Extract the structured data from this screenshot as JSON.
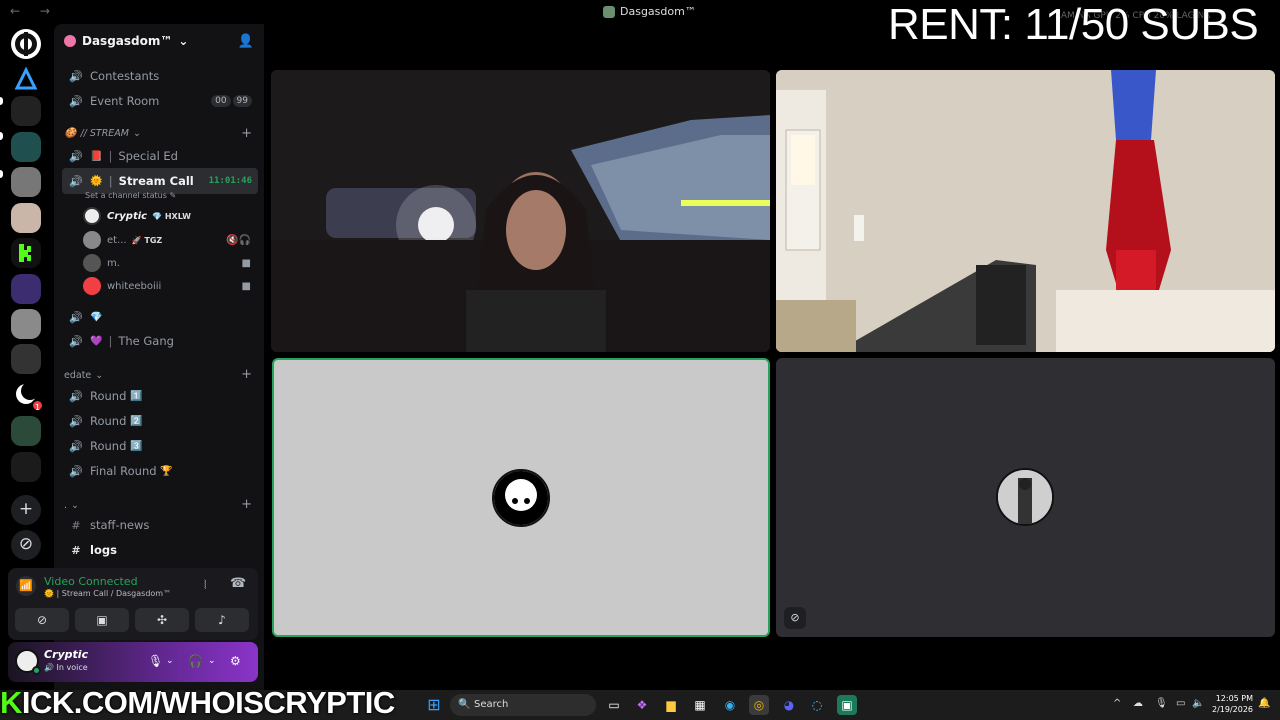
{
  "window": {
    "title": "Dasgasdom™",
    "nav_arrows": "← →"
  },
  "overlay": {
    "rent_text": "RENT: 11/50 SUBS",
    "stats_text": "RAM NA GPU 2% CPU 28% LAG NA",
    "kick_prefix": "K",
    "kick_text": "ICK.COM/WHOISCRYPTIC"
  },
  "server": {
    "name": "Dasgasdom™",
    "chevron": "⌄"
  },
  "channels_top": [
    {
      "name": "Contestants",
      "icon": "speaker"
    },
    {
      "name": "Event Room",
      "icon": "speaker",
      "count_a": "00",
      "count_b": "99"
    }
  ],
  "categories": {
    "stream": "// STREAM",
    "edate": "edate",
    "dot": "."
  },
  "stream_channels": [
    {
      "emoji": "📕",
      "name": "Special Ed"
    },
    {
      "emoji": "🌞",
      "name": "Stream Call",
      "timer": "11:01:46",
      "status": "Set a channel status ✎"
    },
    {
      "emoji": "💎",
      "name": ""
    },
    {
      "emoji": "💜",
      "name": "The Gang"
    }
  ],
  "voice_users": [
    {
      "name": "Cryptic",
      "tag": "HXLW"
    },
    {
      "name": "et...",
      "tag": "TGZ"
    },
    {
      "name": "m.",
      "tag": ""
    },
    {
      "name": "whiteeboiii",
      "tag": ""
    }
  ],
  "edate_channels": [
    {
      "name": "Round",
      "emoji": "1️⃣"
    },
    {
      "name": "Round",
      "emoji": "2️⃣"
    },
    {
      "name": "Round",
      "emoji": "3️⃣"
    },
    {
      "name": "Final Round",
      "emoji": "🏆"
    }
  ],
  "text_channels": [
    {
      "name": "staff-news"
    },
    {
      "name": "logs"
    }
  ],
  "voice_panel": {
    "title": "Video Connected",
    "subtitle": "Stream Call / Dasgasdom™"
  },
  "user_panel": {
    "name": "Cryptic",
    "status": "In voice"
  },
  "taskbar": {
    "search_placeholder": "Search",
    "time": "12:05 PM",
    "date": "2/19/2026"
  },
  "colors": {
    "accent_green": "#23a55a",
    "discord_bg": "#121214",
    "kick_green": "#53fc18"
  }
}
